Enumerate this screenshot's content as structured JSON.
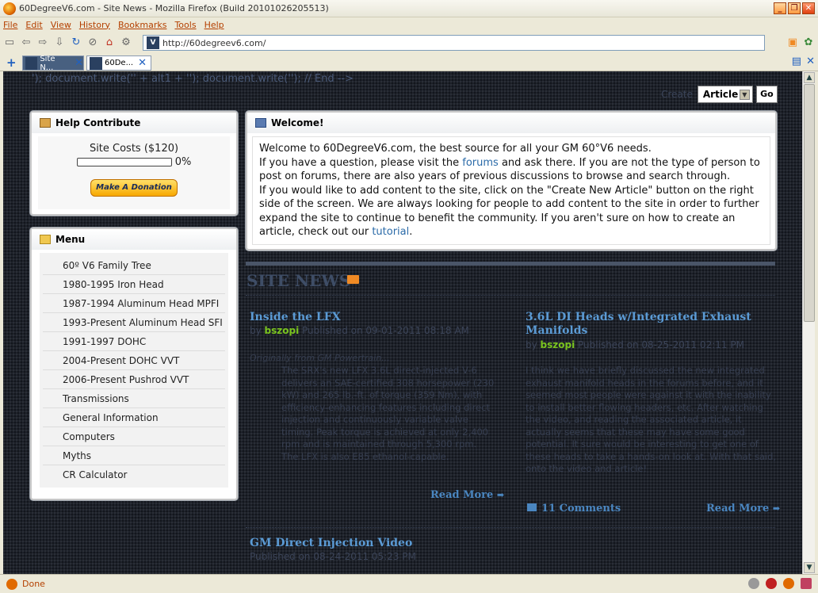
{
  "window": {
    "title": "60DegreeV6.com - Site News - Mozilla Firefox (Build 20101026205513)",
    "buttons": [
      "_",
      "❐",
      "✕"
    ]
  },
  "menubar": [
    "File",
    "Edit",
    "View",
    "History",
    "Bookmarks",
    "Tools",
    "Help"
  ],
  "navbar": {
    "url": "http://60degreev6.com/",
    "icons": [
      "bookmarks-icon",
      "back-icon",
      "forward-icon",
      "reload-icon",
      "stop-icon",
      "home-icon",
      "tools-icon"
    ]
  },
  "tabs": [
    {
      "label": "Site N...",
      "active": false
    },
    {
      "label": "60De...",
      "active": true
    }
  ],
  "page": {
    "script_garbage": "'); document.write('' + alt1 + ''); document.write(''); // End -->",
    "create": {
      "label": "Create",
      "select_value": "Article",
      "go_label": "Go"
    },
    "help": {
      "title": "Help Contribute",
      "costs_label": "Site Costs ($120)",
      "progress_pct": "0%",
      "progress_value": 0,
      "donate_label": "Make A Donation"
    },
    "menu": {
      "title": "Menu",
      "items": [
        "60º V6 Family Tree",
        "1980-1995 Iron Head",
        "1987-1994 Aluminum Head MPFI",
        "1993-Present Aluminum Head SFI",
        "1991-1997 DOHC",
        "2004-Present DOHC VVT",
        "2006-Present Pushrod VVT",
        "Transmissions",
        "General Information",
        "Computers",
        "Myths",
        "CR Calculator"
      ]
    },
    "welcome": {
      "title": "Welcome!",
      "line1": "Welcome to 60DegreeV6.com, the best source for all your GM 60°V6 needs.",
      "line2_a": "If you have a question, please visit the ",
      "line2_link": "forums",
      "line2_b": " and ask there. If you are not the type of person to post on forums, there are also years of previous discussions to browse and search through.",
      "line3_a": "If you would like to add content to the site, click on the \"Create New Article\" button on the right side of the screen. We are always looking for people to add content to the site in order to further expand the site to continue to benefit the community. If you aren't sure on how to create an article, check out our ",
      "line3_link": "tutorial",
      "line3_b": "."
    },
    "news": {
      "heading": "SITE NEWS",
      "articles": [
        {
          "title": "Inside the LFX",
          "by": "by ",
          "author": "bszopi",
          "published": " Published on 09-01-2011 08:18 AM",
          "intro": "Originally from GM Powertrain...",
          "text": "The SRX's new LFX 3.6L direct-injected V-6 delivers an SAE-certified 308 horsepower (230 kW) and 265 lb.-ft. of torque (359 Nm), with efficiency-enhancing features including direct injection and continuously variable valve timing. Peak torque is achieved at only 2,400 rpm and is maintained through 5,300 rpm. The LFX is also E85 ethanol-capable.",
          "read_more": "Read More"
        },
        {
          "title": "3.6L DI Heads w/Integrated Exhaust Manifolds",
          "by": "by ",
          "author": "bszopi",
          "published": " Published on 08-25-2011 02:11 PM",
          "text": "I think we have briefly discussed the new integrated exhaust manifold heads in the forums before, and it seemed most people were against it with the inability to install better flowing headers, etc. After watching the video, and reading the associated article, it actually seems that these may have some good potential. It sure would be interesting to get one of these heads to take a hands-on look at. With that said, onto the video and article!",
          "comments": "11 Comments",
          "read_more": "Read More"
        },
        {
          "title": "GM Direct Injection Video",
          "published": "Published on 08-24-2011 05:23 PM"
        }
      ]
    }
  },
  "statusbar": {
    "text": "Done"
  }
}
